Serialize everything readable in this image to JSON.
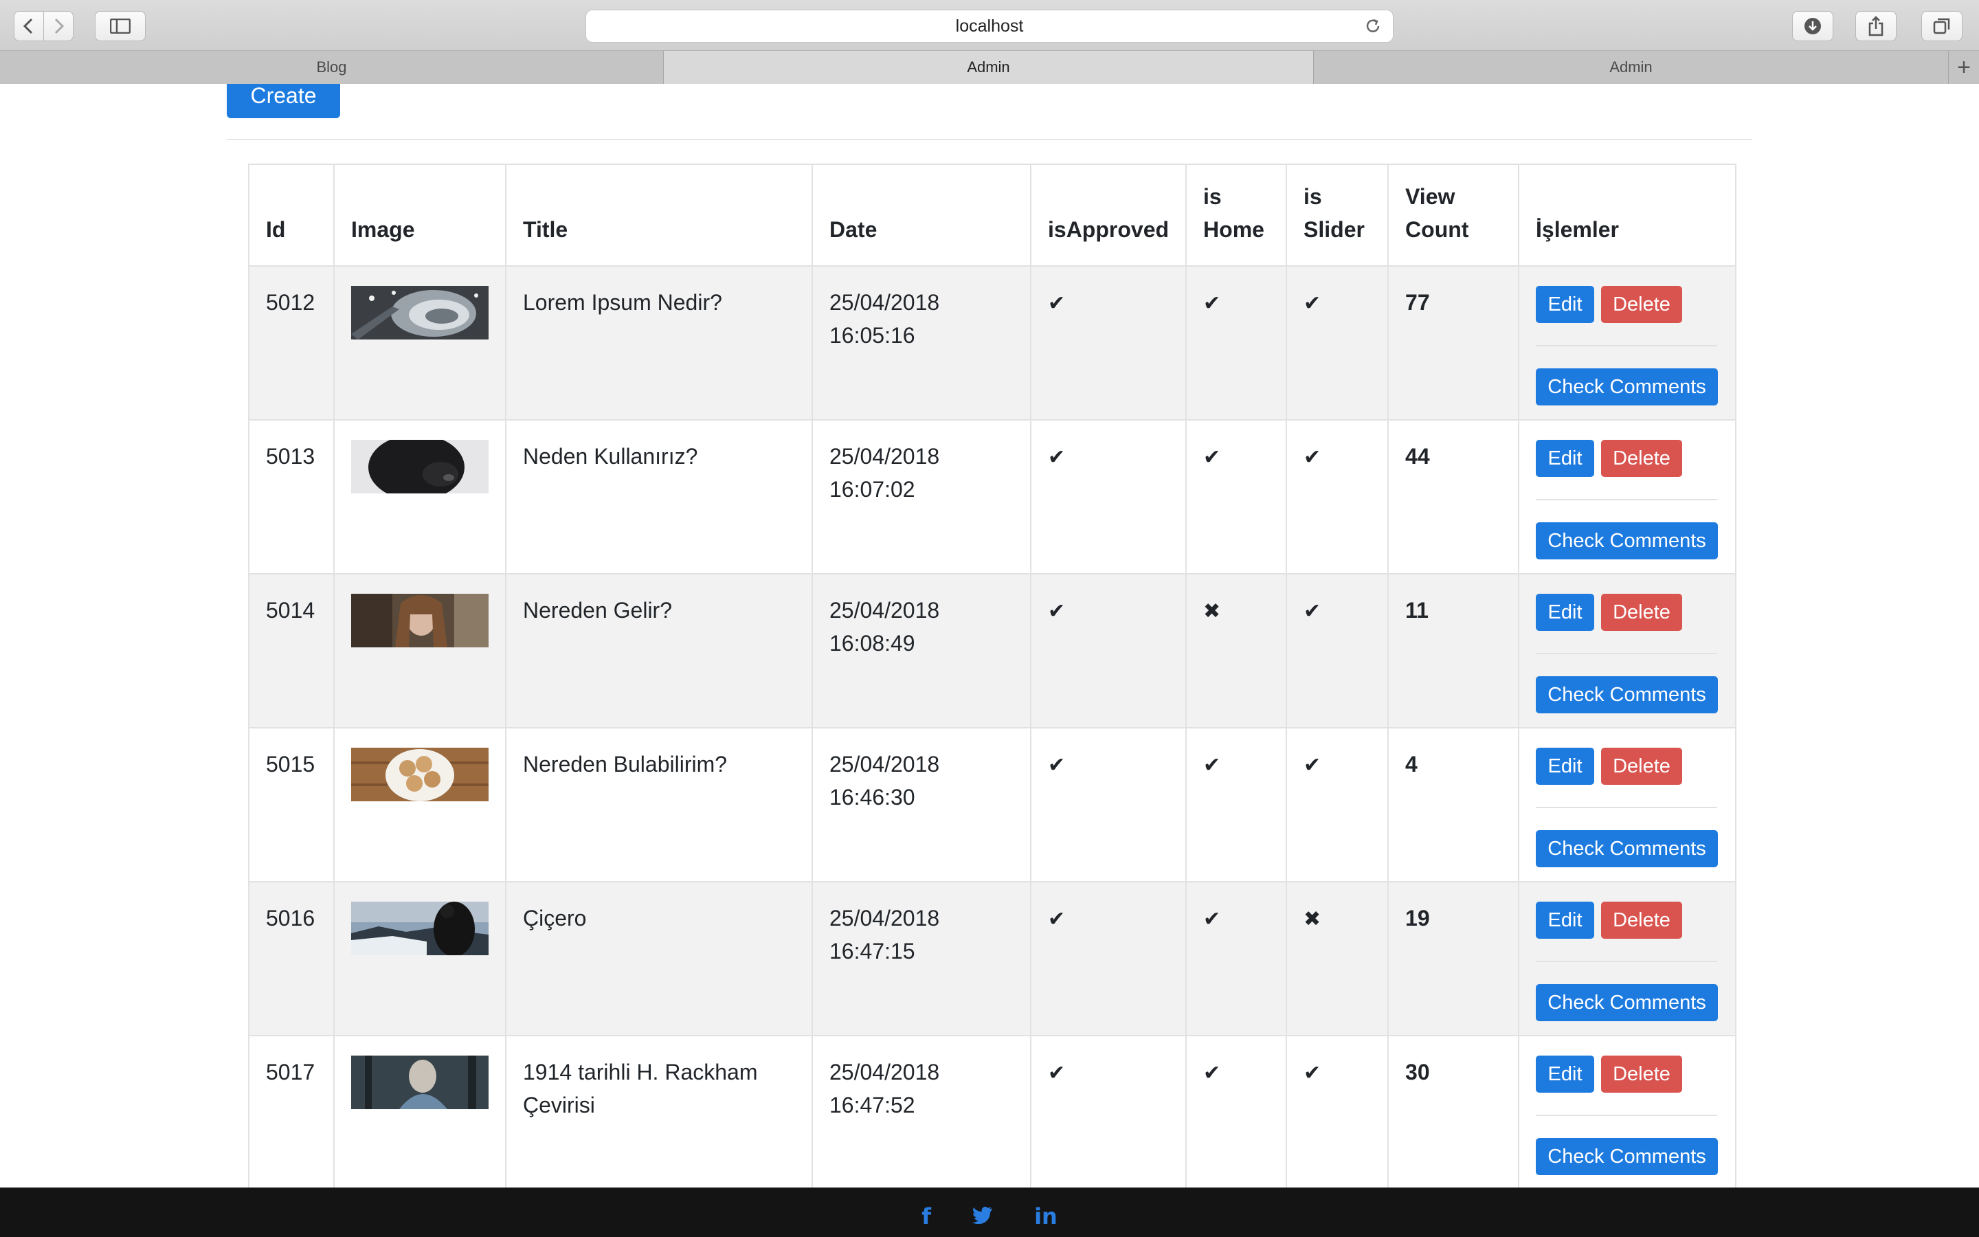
{
  "browser": {
    "address": "localhost",
    "tabs": [
      {
        "label": "Blog",
        "active": false
      },
      {
        "label": "Admin",
        "active": true
      },
      {
        "label": "Admin",
        "active": false
      }
    ],
    "new_tab_label": "+"
  },
  "page": {
    "create_label": "Create",
    "table": {
      "headers": {
        "id": "Id",
        "image": "Image",
        "title": "Title",
        "date_line1": "Date",
        "approved": "isApproved",
        "home_line1": "is",
        "home_line2": "Home",
        "slider_line1": "is",
        "slider_line2": "Slider",
        "views_line1": "View",
        "views_line2": "Count",
        "ops": "İşlemler"
      },
      "rows": [
        {
          "id": "5012",
          "image": "architecture",
          "title": "Lorem Ipsum Nedir?",
          "date": "25/04/2018",
          "time": "16:05:16",
          "approved": "✔",
          "home": "✔",
          "slider": "✔",
          "views": "77"
        },
        {
          "id": "5013",
          "image": "dog",
          "title": "Neden Kullanırız?",
          "date": "25/04/2018",
          "time": "16:07:02",
          "approved": "✔",
          "home": "✔",
          "slider": "✔",
          "views": "44"
        },
        {
          "id": "5014",
          "image": "woman",
          "title": "Nereden Gelir?",
          "date": "25/04/2018",
          "time": "16:08:49",
          "approved": "✔",
          "home": "✖",
          "slider": "✔",
          "views": "11"
        },
        {
          "id": "5015",
          "image": "cookies",
          "title": "Nereden Bulabilirim?",
          "date": "25/04/2018",
          "time": "16:46:30",
          "approved": "✔",
          "home": "✔",
          "slider": "✔",
          "views": "4"
        },
        {
          "id": "5016",
          "image": "photographer",
          "title": "Çiçero",
          "date": "25/04/2018",
          "time": "16:47:15",
          "approved": "✔",
          "home": "✔",
          "slider": "✖",
          "views": "19"
        },
        {
          "id": "5017",
          "image": "forest-person",
          "title": "1914 tarihli H. Rackham Çevirisi",
          "date": "25/04/2018",
          "time": "16:47:52",
          "approved": "✔",
          "home": "✔",
          "slider": "✔",
          "views": "30"
        }
      ],
      "actions": {
        "edit": "Edit",
        "delete": "Delete",
        "check_comments": "Check Comments"
      }
    }
  },
  "footer": {
    "social": [
      {
        "icon": "facebook-icon",
        "glyph": "f"
      },
      {
        "icon": "twitter-icon",
        "glyph": "t"
      },
      {
        "icon": "linkedin-icon",
        "glyph": "in"
      }
    ]
  },
  "colors": {
    "primary": "#1d7be0",
    "danger": "#d9534f",
    "footer": "#141414"
  }
}
